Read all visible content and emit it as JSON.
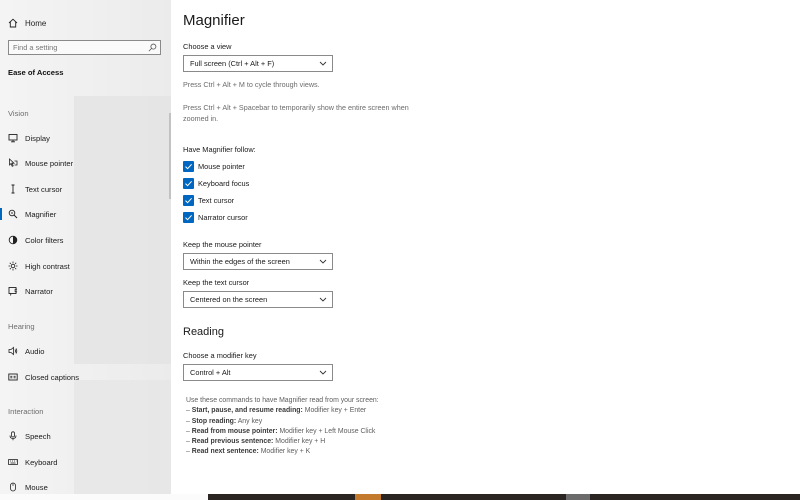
{
  "sidebar": {
    "home_label": "Home",
    "search_placeholder": "Find a setting",
    "title": "Ease of Access",
    "sections": {
      "vision": "Vision",
      "hearing": "Hearing",
      "interaction": "Interaction"
    },
    "items": [
      {
        "label": "Display",
        "icon": "monitor-icon"
      },
      {
        "label": "Mouse pointer",
        "icon": "mouse-pointer-icon"
      },
      {
        "label": "Text cursor",
        "icon": "text-cursor-icon"
      },
      {
        "label": "Magnifier",
        "icon": "magnifier-icon",
        "active": true
      },
      {
        "label": "Color filters",
        "icon": "color-filter-icon"
      },
      {
        "label": "High contrast",
        "icon": "sun-icon"
      },
      {
        "label": "Narrator",
        "icon": "narrator-icon"
      },
      {
        "label": "Audio",
        "icon": "speaker-icon"
      },
      {
        "label": "Closed captions",
        "icon": "captions-icon"
      },
      {
        "label": "Speech",
        "icon": "microphone-icon"
      },
      {
        "label": "Keyboard",
        "icon": "keyboard-icon"
      },
      {
        "label": "Mouse",
        "icon": "mouse-icon"
      }
    ]
  },
  "main": {
    "title": "Magnifier",
    "view": {
      "label": "Choose a view",
      "value": "Full screen (Ctrl + Alt + F)",
      "hint1": "Press Ctrl + Alt + M to cycle through views.",
      "hint2": "Press Ctrl + Alt + Spacebar to temporarily show the entire screen when zoomed in."
    },
    "follow": {
      "label": "Have Magnifier follow:",
      "options": [
        {
          "label": "Mouse pointer",
          "checked": true
        },
        {
          "label": "Keyboard focus",
          "checked": true
        },
        {
          "label": "Text cursor",
          "checked": true
        },
        {
          "label": "Narrator cursor",
          "checked": true
        }
      ]
    },
    "mouse_pointer": {
      "label": "Keep the mouse pointer",
      "value": "Within the edges of the screen"
    },
    "text_cursor": {
      "label": "Keep the text cursor",
      "value": "Centered on the screen"
    },
    "reading": {
      "title": "Reading",
      "modifier_label": "Choose a modifier key",
      "modifier_value": "Control + Alt",
      "intro": "Use these commands to have Magnifier read from your screen:",
      "commands": [
        {
          "name": "Start, pause, and resume reading:",
          "keys": "Modifier key + Enter"
        },
        {
          "name": "Stop reading:",
          "keys": "Any key"
        },
        {
          "name": "Read from mouse pointer:",
          "keys": "Modifier key + Left Mouse Click"
        },
        {
          "name": "Read previous sentence:",
          "keys": "Modifier key + H"
        },
        {
          "name": "Read next sentence:",
          "keys": "Modifier key + K"
        }
      ]
    }
  },
  "colors": {
    "accent": "#0067c0",
    "sidebar_bg": "#f2f2f2"
  }
}
